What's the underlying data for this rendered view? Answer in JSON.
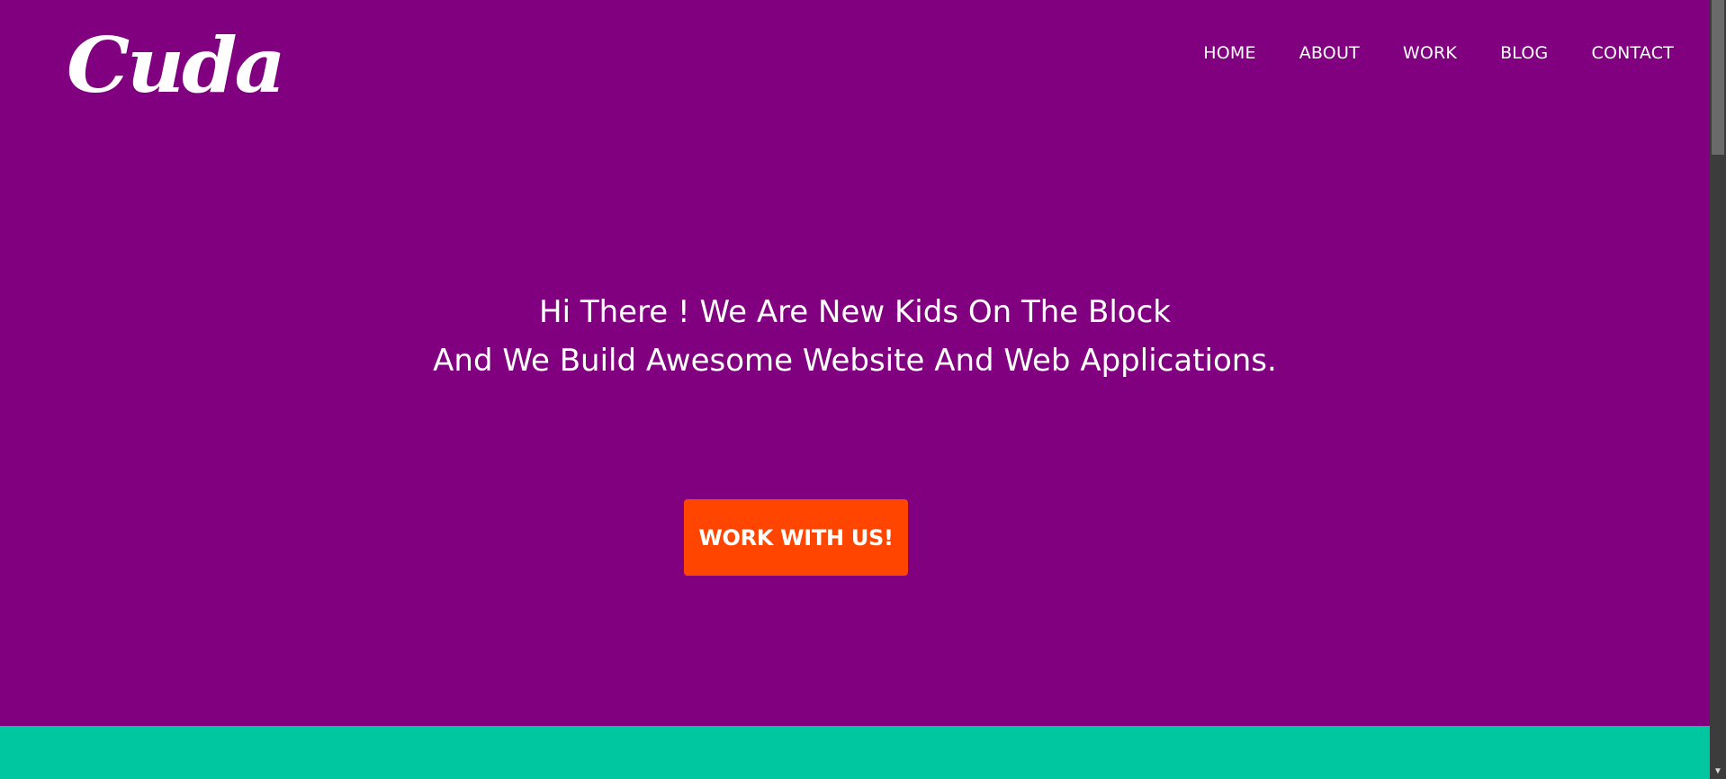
{
  "brand": {
    "logo_text": "Cuda"
  },
  "nav": {
    "items": [
      {
        "label": "HOME"
      },
      {
        "label": "ABOUT"
      },
      {
        "label": "WORK"
      },
      {
        "label": "BLOG"
      },
      {
        "label": "CONTACT"
      }
    ]
  },
  "hero": {
    "line1": "Hi There ! We Are New Kids On The Block",
    "line2": "And We Build Awesome Website And Web Applications.",
    "cta_label": "WORK WITH US!"
  },
  "scrollbar": {
    "down_arrow": "▼"
  },
  "colors": {
    "hero_background": "#800080",
    "cta_background": "#ff4500",
    "band_background": "#00c7a0",
    "text": "#ffffff"
  }
}
